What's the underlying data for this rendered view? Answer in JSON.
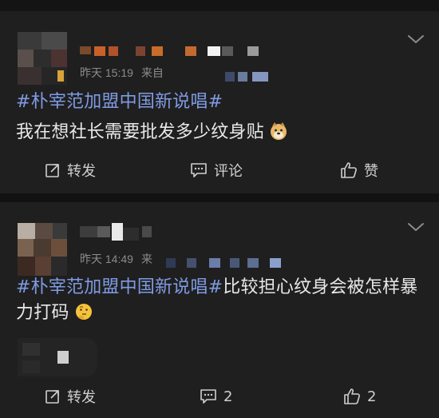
{
  "posts": [
    {
      "time": "昨天 15:19",
      "source": "来自",
      "hashtag": "#朴宰范加盟中国新说唱#",
      "text": "我在想社长需要批发多少纹身贴",
      "emoji_icon": "dog-face-icon",
      "actions": {
        "repost": "转发",
        "comment": "评论",
        "like": "赞"
      }
    },
    {
      "time": "昨天 14:49",
      "source": "来",
      "hashtag": "#朴宰范加盟中国新说唱#",
      "text": "比较担心纹身会被怎样暴力打码",
      "emoji_icon": "thinking-face-icon",
      "actions": {
        "repost": "转发",
        "comment": "2",
        "like": "2"
      }
    }
  ],
  "colors": {
    "background": "#141414",
    "card": "#1f1f1f",
    "hashtag": "#7f9be3",
    "meta": "#8b8b8b"
  }
}
